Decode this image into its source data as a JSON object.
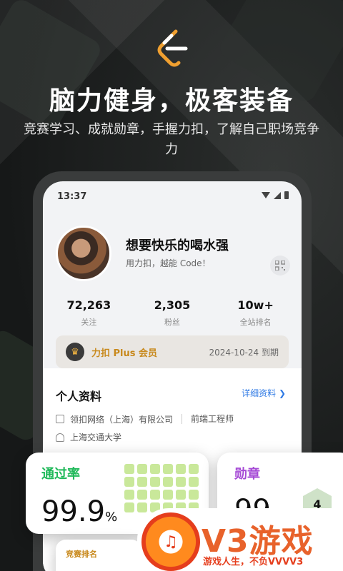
{
  "hero": {
    "headline": "脑力健身，极客装备",
    "subline": "竞赛学习、成就勋章，手握力扣，了解自己职场竞争力"
  },
  "phone": {
    "status_time": "13:37",
    "profile": {
      "name": "想要快乐的喝水强",
      "bio": "用力扣，越能 Code！"
    },
    "stats": [
      {
        "value": "72,263",
        "label": "关注"
      },
      {
        "value": "2,305",
        "label": "粉丝"
      },
      {
        "value": "10w+",
        "label": "全站排名"
      }
    ],
    "membership": {
      "label": "力扣 Plus 会员",
      "expiry": "2024-10-24 到期"
    },
    "personal_info": {
      "title": "个人资料",
      "detail_link": "详细资料",
      "company": "领扣网络（上海）有限公司",
      "role": "前端工程师",
      "school": "上海交通大学"
    }
  },
  "cards": {
    "pass_rate": {
      "title": "通过率",
      "value": "99.9",
      "unit": "%"
    },
    "badges": {
      "title": "勋章",
      "value": "99",
      "level": "4"
    },
    "ranking": {
      "title": "竞赛排名"
    }
  },
  "watermark": {
    "brand": "V3游戏",
    "slogan": "游戏人生，不负VVVV3"
  },
  "colors": {
    "accent_orange": "#f2b441",
    "pass_green": "#20b95a",
    "badge_purple": "#a64bd6",
    "link_blue": "#2f7ae5"
  }
}
